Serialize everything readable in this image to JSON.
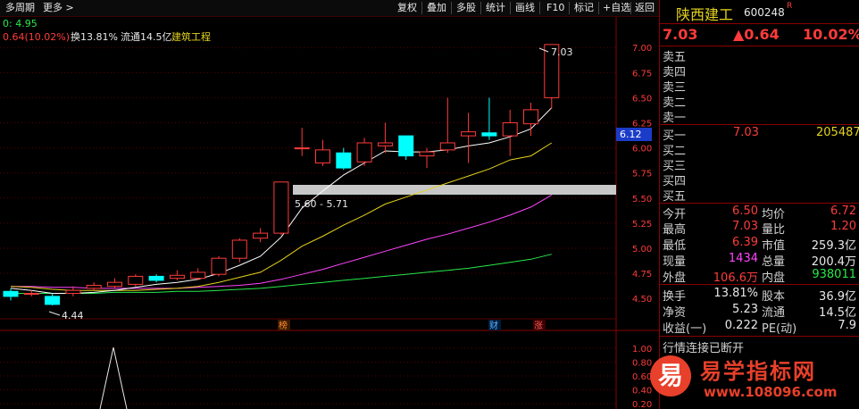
{
  "toolbar": {
    "left_items": [
      {
        "label": "多周期",
        "name": "multi-period-button"
      },
      {
        "label": "更多 >",
        "name": "more-button"
      }
    ],
    "right_items": [
      {
        "label": "复权",
        "name": "restore-rights-button"
      },
      {
        "label": "叠加",
        "name": "overlay-button"
      },
      {
        "label": "多股",
        "name": "multi-stock-button"
      },
      {
        "label": "统计",
        "name": "statistics-button"
      },
      {
        "label": "画线",
        "name": "draw-line-button"
      },
      {
        "label": "F10",
        "name": "f10-button"
      },
      {
        "label": "标记",
        "name": "mark-button"
      },
      {
        "label": "+自选",
        "name": "add-watchlist-button"
      },
      {
        "label": "返回",
        "name": "back-button"
      }
    ]
  },
  "chart": {
    "info_line1": "0: 4.95",
    "info_change": "0.64(10.02%)",
    "info_turnover": "换13.81%",
    "info_float": "流通14.5亿",
    "info_sector": "建筑工程",
    "last_price_tag": "6.12",
    "max_label": "7.03",
    "min_label": "4.44",
    "zone_label": "5.60 - 5.71",
    "markers": [
      "榜",
      "财",
      "涨"
    ],
    "y_labels": [
      "7.00",
      "6.75",
      "6.50",
      "6.25",
      "6.00",
      "5.75",
      "5.50",
      "5.25",
      "5.00",
      "4.75",
      "4.50"
    ],
    "sub_y_labels": [
      "1.00",
      "0.80",
      "0.60",
      "0.40",
      "0.20"
    ],
    "colors": {
      "up": "#ff3b3b",
      "down": "#00ffff",
      "ma5": "#ffffff",
      "ma10": "#e4d21c",
      "ma20": "#ff44ff",
      "ma60": "#27e94a",
      "zone": "#c8c8c8"
    }
  },
  "chart_data": {
    "type": "candlestick",
    "ylim": [
      4.35,
      7.1
    ],
    "candles": [
      {
        "o": 4.57,
        "c": 4.52,
        "h": 4.6,
        "l": 4.48
      },
      {
        "o": 4.55,
        "c": 4.55,
        "h": 4.58,
        "l": 4.52
      },
      {
        "o": 4.52,
        "c": 4.44,
        "h": 4.55,
        "l": 4.43
      },
      {
        "o": 4.55,
        "c": 4.58,
        "h": 4.62,
        "l": 4.52
      },
      {
        "o": 4.6,
        "c": 4.63,
        "h": 4.66,
        "l": 4.58
      },
      {
        "o": 4.62,
        "c": 4.66,
        "h": 4.7,
        "l": 4.6
      },
      {
        "o": 4.64,
        "c": 4.72,
        "h": 4.74,
        "l": 4.62
      },
      {
        "o": 4.72,
        "c": 4.68,
        "h": 4.74,
        "l": 4.66
      },
      {
        "o": 4.7,
        "c": 4.73,
        "h": 4.78,
        "l": 4.68
      },
      {
        "o": 4.7,
        "c": 4.76,
        "h": 4.8,
        "l": 4.68
      },
      {
        "o": 4.74,
        "c": 4.9,
        "h": 4.92,
        "l": 4.72
      },
      {
        "o": 4.9,
        "c": 5.08,
        "h": 5.1,
        "l": 4.86
      },
      {
        "o": 5.1,
        "c": 5.15,
        "h": 5.2,
        "l": 5.06
      },
      {
        "o": 5.15,
        "c": 5.66,
        "h": 5.66,
        "l": 5.13
      },
      {
        "o": 6.0,
        "c": 6.0,
        "h": 6.2,
        "l": 5.92
      },
      {
        "o": 5.85,
        "c": 5.98,
        "h": 6.08,
        "l": 5.82
      },
      {
        "o": 5.95,
        "c": 5.8,
        "h": 6.0,
        "l": 5.78
      },
      {
        "o": 5.86,
        "c": 6.05,
        "h": 6.1,
        "l": 5.82
      },
      {
        "o": 6.02,
        "c": 6.05,
        "h": 6.25,
        "l": 5.95
      },
      {
        "o": 6.12,
        "c": 5.92,
        "h": 6.12,
        "l": 5.88
      },
      {
        "o": 5.92,
        "c": 5.96,
        "h": 6.0,
        "l": 5.8
      },
      {
        "o": 5.98,
        "c": 6.05,
        "h": 6.5,
        "l": 5.95
      },
      {
        "o": 6.12,
        "c": 6.16,
        "h": 6.35,
        "l": 5.85
      },
      {
        "o": 6.15,
        "c": 6.12,
        "h": 6.5,
        "l": 6.08
      },
      {
        "o": 6.12,
        "c": 6.25,
        "h": 6.38,
        "l": 5.92
      },
      {
        "o": 6.24,
        "c": 6.38,
        "h": 6.45,
        "l": 6.12
      },
      {
        "o": 6.5,
        "c": 7.03,
        "h": 7.03,
        "l": 6.39
      }
    ],
    "ma5": [
      4.6,
      4.58,
      4.55,
      4.55,
      4.56,
      4.58,
      4.61,
      4.64,
      4.66,
      4.69,
      4.75,
      4.83,
      4.92,
      5.11,
      5.4,
      5.57,
      5.73,
      5.85,
      5.97,
      5.96,
      5.96,
      5.98,
      6.02,
      6.05,
      6.11,
      6.19,
      6.4
    ],
    "ma10": [
      4.62,
      4.61,
      4.59,
      4.58,
      4.58,
      4.58,
      4.58,
      4.59,
      4.6,
      4.62,
      4.66,
      4.71,
      4.76,
      4.88,
      5.02,
      5.12,
      5.23,
      5.33,
      5.44,
      5.51,
      5.58,
      5.65,
      5.72,
      5.79,
      5.88,
      5.92,
      6.05
    ],
    "ma20": [
      4.62,
      4.62,
      4.61,
      4.61,
      4.6,
      4.6,
      4.6,
      4.6,
      4.6,
      4.61,
      4.62,
      4.63,
      4.65,
      4.69,
      4.74,
      4.79,
      4.85,
      4.91,
      4.97,
      5.03,
      5.09,
      5.14,
      5.2,
      5.26,
      5.33,
      5.41,
      5.53
    ],
    "ma60": [
      4.55,
      4.55,
      4.55,
      4.55,
      4.55,
      4.56,
      4.56,
      4.56,
      4.57,
      4.57,
      4.58,
      4.59,
      4.6,
      4.62,
      4.64,
      4.66,
      4.68,
      4.7,
      4.72,
      4.74,
      4.76,
      4.78,
      4.8,
      4.83,
      4.86,
      4.89,
      4.94
    ],
    "zone": [
      5.6,
      5.71
    ]
  },
  "right_panel": {
    "stock_name": "陕西建工",
    "stock_code": "600248",
    "r_badge": "R",
    "price": "7.03",
    "change": "▲0.64",
    "change_pct": "10.02%",
    "asks": [
      {
        "label": "卖五",
        "price": "",
        "vol": ""
      },
      {
        "label": "卖四",
        "price": "",
        "vol": ""
      },
      {
        "label": "卖三",
        "price": "",
        "vol": ""
      },
      {
        "label": "卖二",
        "price": "",
        "vol": ""
      },
      {
        "label": "卖一",
        "price": "",
        "vol": ""
      }
    ],
    "bids": [
      {
        "label": "买一",
        "price": "7.03",
        "vol": "205487"
      },
      {
        "label": "买二",
        "price": "",
        "vol": ""
      },
      {
        "label": "买三",
        "price": "",
        "vol": ""
      },
      {
        "label": "买四",
        "price": "",
        "vol": ""
      },
      {
        "label": "买五",
        "price": "",
        "vol": ""
      }
    ],
    "stats": [
      {
        "l1": "今开",
        "v1": "6.50",
        "c1": "red",
        "l2": "均价",
        "v2": "6.72",
        "c2": "red"
      },
      {
        "l1": "最高",
        "v1": "7.03",
        "c1": "red",
        "l2": "量比",
        "v2": "1.20",
        "c2": "red"
      },
      {
        "l1": "最低",
        "v1": "6.39",
        "c1": "red",
        "l2": "市值",
        "v2": "259.3亿",
        "c2": "wht"
      },
      {
        "l1": "现量",
        "v1": "1434",
        "c1": "mag",
        "l2": "总量",
        "v2": "200.4万",
        "c2": "wht"
      },
      {
        "l1": "外盘",
        "v1": "106.6万",
        "c1": "red",
        "l2": "内盘",
        "v2": "938011",
        "c2": "grn"
      },
      {
        "l1": "换手",
        "v1": "13.81%",
        "c1": "wht",
        "l2": "股本",
        "v2": "36.9亿",
        "c2": "wht"
      },
      {
        "l1": "净资",
        "v1": "5.23",
        "c1": "wht",
        "l2": "流通",
        "v2": "14.5亿",
        "c2": "wht"
      },
      {
        "l1": "收益(一)",
        "v1": "0.222",
        "c1": "wht",
        "l2": "PE(动)",
        "v2": "7.9",
        "c2": "wht"
      }
    ],
    "status": "行情连接已断开"
  },
  "watermark": {
    "logo_char": "易",
    "title": "易学指标网",
    "url": "www.108096.com"
  }
}
